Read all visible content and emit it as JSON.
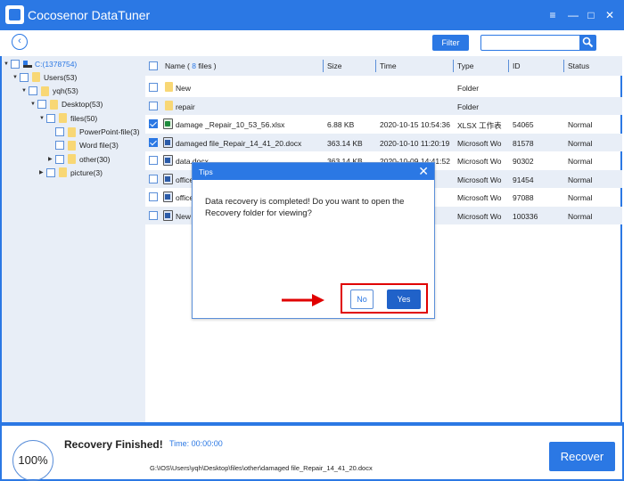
{
  "app": {
    "title": "Cocosenor DataTuner"
  },
  "window_controls": {
    "menu": "≡",
    "minimize": "—",
    "maximize": "□",
    "close": "✕"
  },
  "toolbar": {
    "back_icon": "‹",
    "filter_label": "Filter",
    "search_value": "",
    "search_placeholder": ""
  },
  "tree": [
    {
      "label": "C:(1378754)",
      "level": 0,
      "expanded": true,
      "type": "drive"
    },
    {
      "label": "Users(53)",
      "level": 1,
      "expanded": true,
      "type": "folder"
    },
    {
      "label": "yqh(53)",
      "level": 2,
      "expanded": true,
      "type": "folder"
    },
    {
      "label": "Desktop(53)",
      "level": 3,
      "expanded": true,
      "type": "folder"
    },
    {
      "label": "files(50)",
      "level": 4,
      "expanded": true,
      "type": "folder"
    },
    {
      "label": "PowerPoint-file(3)",
      "level": 5,
      "expanded": null,
      "type": "folder"
    },
    {
      "label": "Word file(3)",
      "level": 5,
      "expanded": null,
      "type": "folder"
    },
    {
      "label": "other(30)",
      "level": 5,
      "expanded": false,
      "type": "folder"
    },
    {
      "label": "picture(3)",
      "level": 4,
      "expanded": false,
      "type": "folder"
    }
  ],
  "table": {
    "headers": {
      "name_prefix": "Name ( ",
      "count": "8",
      "name_suffix": " files )",
      "size": "Size",
      "time": "Time",
      "type": "Type",
      "id": "ID",
      "status": "Status"
    },
    "rows": [
      {
        "name": "New",
        "icon": "folder",
        "checked": false,
        "size": "",
        "time": "",
        "type": "Folder",
        "id": "",
        "status": ""
      },
      {
        "name": "repair",
        "icon": "folder",
        "checked": false,
        "size": "",
        "time": "",
        "type": "Folder",
        "id": "",
        "status": ""
      },
      {
        "name": "damage _Repair_10_53_56.xlsx",
        "icon": "excel",
        "checked": true,
        "size": "6.88 KB",
        "time": "2020-10-15 10:54:36",
        "type": "XLSX 工作表",
        "id": "54065",
        "status": "Normal"
      },
      {
        "name": "damaged file_Repair_14_41_20.docx",
        "icon": "word",
        "checked": true,
        "size": "363.14 KB",
        "time": "2020-10-10 11:20:19",
        "type": "Microsoft Wo",
        "id": "81578",
        "status": "Normal"
      },
      {
        "name": "data.docx",
        "icon": "word",
        "checked": false,
        "size": "363.14 KB",
        "time": "2020-10-09 14:41:52",
        "type": "Microsoft Wo",
        "id": "90302",
        "status": "Normal"
      },
      {
        "name": "office",
        "icon": "word",
        "checked": false,
        "size": "",
        "time": "06",
        "type": "Microsoft Wo",
        "id": "91454",
        "status": "Normal"
      },
      {
        "name": "office",
        "icon": "word",
        "checked": false,
        "size": "",
        "time": "13",
        "type": "Microsoft Wo",
        "id": "97088",
        "status": "Normal"
      },
      {
        "name": "New",
        "icon": "word",
        "checked": false,
        "size": "",
        "time": "33",
        "type": "Microsoft Wo",
        "id": "100336",
        "status": "Normal"
      }
    ]
  },
  "dialog": {
    "title": "Tips",
    "close_icon": "✕",
    "message": "Data recovery is completed! Do you want to open the Recovery folder for viewing?",
    "no_label": "No",
    "yes_label": "Yes"
  },
  "status": {
    "progress_percent": 100,
    "progress_label": "100%",
    "title": "Recovery Finished!",
    "time_label": "Time:  00:00:00",
    "path": "G:\\IOS\\Users\\yqh\\Desktop\\files\\other\\damaged file_Repair_14_41_20.docx",
    "recover_label": "Recover"
  },
  "colors": {
    "accent": "#2b78e4",
    "row_alt": "#e8eef7",
    "annotation": "#e00000"
  }
}
